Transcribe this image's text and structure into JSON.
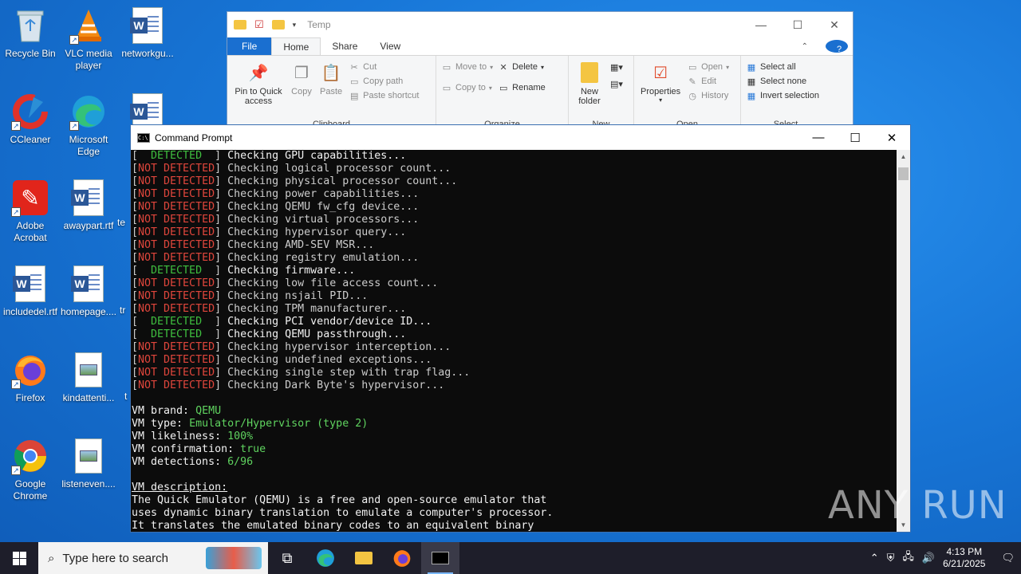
{
  "desktop": {
    "icons": [
      {
        "label": "Recycle Bin",
        "icon": "recycle-bin-icon"
      },
      {
        "label": "VLC media player",
        "icon": "vlc-icon"
      },
      {
        "label": "networkgu...",
        "icon": "word-doc-icon"
      },
      {
        "label": "CCleaner",
        "icon": "ccleaner-icon"
      },
      {
        "label": "Microsoft Edge",
        "icon": "edge-icon"
      },
      {
        "label": "Adobe Acrobat",
        "icon": "acrobat-icon"
      },
      {
        "label": "awaypart.rtf",
        "icon": "word-doc-icon"
      },
      {
        "label": "includedel.rtf",
        "icon": "word-doc-icon"
      },
      {
        "label": "homepage....",
        "icon": "word-doc-icon"
      },
      {
        "label": "Firefox",
        "icon": "firefox-icon"
      },
      {
        "label": "kindattenti...",
        "icon": "image-doc-icon"
      },
      {
        "label": "Google Chrome",
        "icon": "chrome-icon"
      },
      {
        "label": "listeneven....",
        "icon": "image-doc-icon"
      }
    ],
    "partial_labels": [
      "te",
      "tr",
      "t"
    ]
  },
  "explorer": {
    "title": "Temp",
    "tabs": {
      "file": "File",
      "home": "Home",
      "share": "Share",
      "view": "View"
    },
    "clipboard": {
      "pin": "Pin to Quick access",
      "copy": "Copy",
      "paste": "Paste",
      "cut": "Cut",
      "copy_path": "Copy path",
      "paste_shortcut": "Paste shortcut",
      "group": "Clipboard"
    },
    "organize": {
      "move_to": "Move to",
      "copy_to": "Copy to",
      "delete": "Delete",
      "rename": "Rename",
      "group": "Organize"
    },
    "new": {
      "new_folder": "New folder",
      "group": "New"
    },
    "open": {
      "properties": "Properties",
      "open": "Open",
      "edit": "Edit",
      "history": "History",
      "group": "Open"
    },
    "select": {
      "select_all": "Select all",
      "select_none": "Select none",
      "invert": "Invert selection",
      "group": "Select"
    }
  },
  "cmd": {
    "title": "Command Prompt",
    "detected_tag": "  DETECTED  ",
    "not_detected_tag": "NOT DETECTED",
    "checks": [
      {
        "status": "detected",
        "text": "Checking GPU capabilities..."
      },
      {
        "status": "not",
        "text": "Checking logical processor count..."
      },
      {
        "status": "not",
        "text": "Checking physical processor count..."
      },
      {
        "status": "not",
        "text": "Checking power capabilities..."
      },
      {
        "status": "not",
        "text": "Checking QEMU fw_cfg device..."
      },
      {
        "status": "not",
        "text": "Checking virtual processors..."
      },
      {
        "status": "not",
        "text": "Checking hypervisor query..."
      },
      {
        "status": "not",
        "text": "Checking AMD-SEV MSR..."
      },
      {
        "status": "not",
        "text": "Checking registry emulation..."
      },
      {
        "status": "detected",
        "text": "Checking firmware..."
      },
      {
        "status": "not",
        "text": "Checking low file access count..."
      },
      {
        "status": "not",
        "text": "Checking nsjail PID..."
      },
      {
        "status": "not",
        "text": "Checking TPM manufacturer..."
      },
      {
        "status": "detected",
        "text": "Checking PCI vendor/device ID..."
      },
      {
        "status": "detected",
        "text": "Checking QEMU passthrough..."
      },
      {
        "status": "not",
        "text": "Checking hypervisor interception..."
      },
      {
        "status": "not",
        "text": "Checking undefined exceptions..."
      },
      {
        "status": "not",
        "text": "Checking single step with trap flag..."
      },
      {
        "status": "not",
        "text": "Checking Dark Byte's hypervisor..."
      }
    ],
    "summary": [
      {
        "key": "VM brand: ",
        "value": "QEMU"
      },
      {
        "key": "VM type: ",
        "value": "Emulator/Hypervisor (type 2)"
      },
      {
        "key": "VM likeliness: ",
        "value": "100%"
      },
      {
        "key": "VM confirmation: ",
        "value": "true"
      },
      {
        "key": "VM detections: ",
        "value": "6/96"
      }
    ],
    "description_header": "VM description:",
    "description_lines": [
      "The Quick Emulator (QEMU) is a free and open-source emulator that",
      "uses dynamic binary translation to emulate a computer's processor.",
      "It translates the emulated binary codes to an equivalent binary"
    ]
  },
  "watermark": "ANY RUN",
  "taskbar": {
    "search_placeholder": "Type here to search",
    "time": "4:13 PM",
    "date": "6/21/2025"
  },
  "colors": {
    "detected": "#3fbf3f",
    "not_detected": "#e0463c",
    "value_green": "#5fd35f"
  }
}
